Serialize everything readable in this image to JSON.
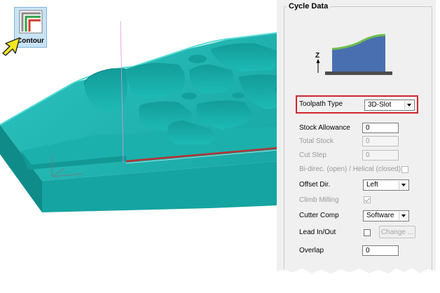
{
  "toolbar": {
    "contour_label": "Contour"
  },
  "panel": {
    "title": "Cycle Data",
    "diagram_axis": "Z",
    "toolpath_type": {
      "label": "Toolpath Type",
      "value": "3D-Slot"
    },
    "stock_allowance": {
      "label": "Stock Allowance",
      "value": "0"
    },
    "total_stock": {
      "label": "Total Stock",
      "value": "0"
    },
    "cut_step": {
      "label": "Cut Step",
      "value": "0"
    },
    "bidirec": {
      "label": "Bi-direc. (open) / Helical (closed)"
    },
    "offset_dir": {
      "label": "Offset Dir.",
      "value": "Left"
    },
    "climb_milling": {
      "label": "Climb Milling"
    },
    "cutter_comp": {
      "label": "Cutter Comp",
      "value": "Software"
    },
    "lead_in_out": {
      "label": "Lead In/Out",
      "button": "Change ..."
    },
    "overlap": {
      "label": "Overlap",
      "value": "0"
    }
  },
  "colors": {
    "part": "#1fb4b0",
    "highlight": "#d0262b",
    "diagram_fill": "#4a6fb0",
    "diagram_edge": "#6cc04a"
  }
}
